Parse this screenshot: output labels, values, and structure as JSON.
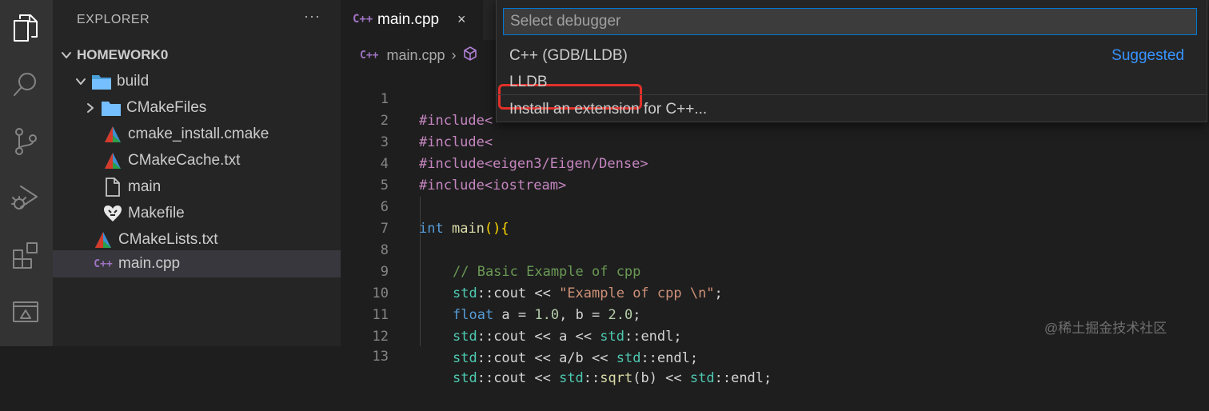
{
  "colors": {
    "accent": "#0078d4",
    "suggested": "#3794ff",
    "highlight_box": "#e0312a",
    "cpp_icon": "#a074c4"
  },
  "activity_bar": {
    "icons": [
      "explorer-icon",
      "search-icon",
      "source-control-icon",
      "run-debug-icon",
      "extensions-icon",
      "remote-explorer-icon"
    ]
  },
  "sidebar": {
    "title": "EXPLORER",
    "more": "···",
    "root": "HOMEWORK0",
    "items": [
      {
        "label": "build",
        "icon": "folder-open-icon"
      },
      {
        "label": "CMakeFiles",
        "icon": "folder-icon"
      },
      {
        "label": "cmake_install.cmake",
        "icon": "cmake-icon"
      },
      {
        "label": "CMakeCache.txt",
        "icon": "cmake-icon"
      },
      {
        "label": "main",
        "icon": "file-icon"
      },
      {
        "label": "Makefile",
        "icon": "makefile-icon"
      },
      {
        "label": "CMakeLists.txt",
        "icon": "cmake-icon"
      },
      {
        "label": "main.cpp",
        "icon": "cpp-file-icon"
      }
    ]
  },
  "editor": {
    "tab": {
      "icon_text": "C++",
      "label": "main.cpp",
      "close": "×"
    },
    "breadcrumb": {
      "icon_text": "C++",
      "file": "main.cpp",
      "sep": "›"
    },
    "line_numbers": [
      "1",
      "2",
      "3",
      "4",
      "5",
      "6",
      "7",
      "8",
      "9",
      "10",
      "11",
      "12",
      "13"
    ],
    "code": {
      "l1": "#include<",
      "l2": "#include<",
      "l3a": "#include<",
      "l3b": "eigen3/Eigen/Dense>",
      "l4": "#include<iostream>",
      "l6_kw": "int",
      "l6_fn": "main",
      "l6_rest": "(){",
      "l8": "// Basic Example of cpp",
      "l9_ns": "std",
      "l9_a": "::cout << ",
      "l9_str": "\"Example of cpp \\n\"",
      "l9_end": ";",
      "l10_kw": "float",
      "l10_a": " a = ",
      "l10_n1": "1.0",
      "l10_b": ", b = ",
      "l10_n2": "2.0",
      "l10_end": ";",
      "l11_ns": "std",
      "l11_a": "::cout << a << ",
      "l11_ns2": "std",
      "l11_b": "::endl;",
      "l12_ns": "std",
      "l12_a": "::cout << a/b << ",
      "l12_ns2": "std",
      "l12_b": "::endl;",
      "l13_ns": "std",
      "l13_a": "::cout << ",
      "l13_ns2": "std",
      "l13_b": "::",
      "l13_fn": "sqrt",
      "l13_c": "(b) << ",
      "l13_ns3": "std",
      "l13_d": "::endl;"
    }
  },
  "quick_pick": {
    "placeholder": "Select debugger",
    "items": [
      {
        "label": "C++ (GDB/LLDB)",
        "detail": "Suggested"
      },
      {
        "label": "LLDB"
      },
      {
        "label": "Install an extension for C++..."
      }
    ]
  },
  "watermark": "@稀土掘金技术社区"
}
